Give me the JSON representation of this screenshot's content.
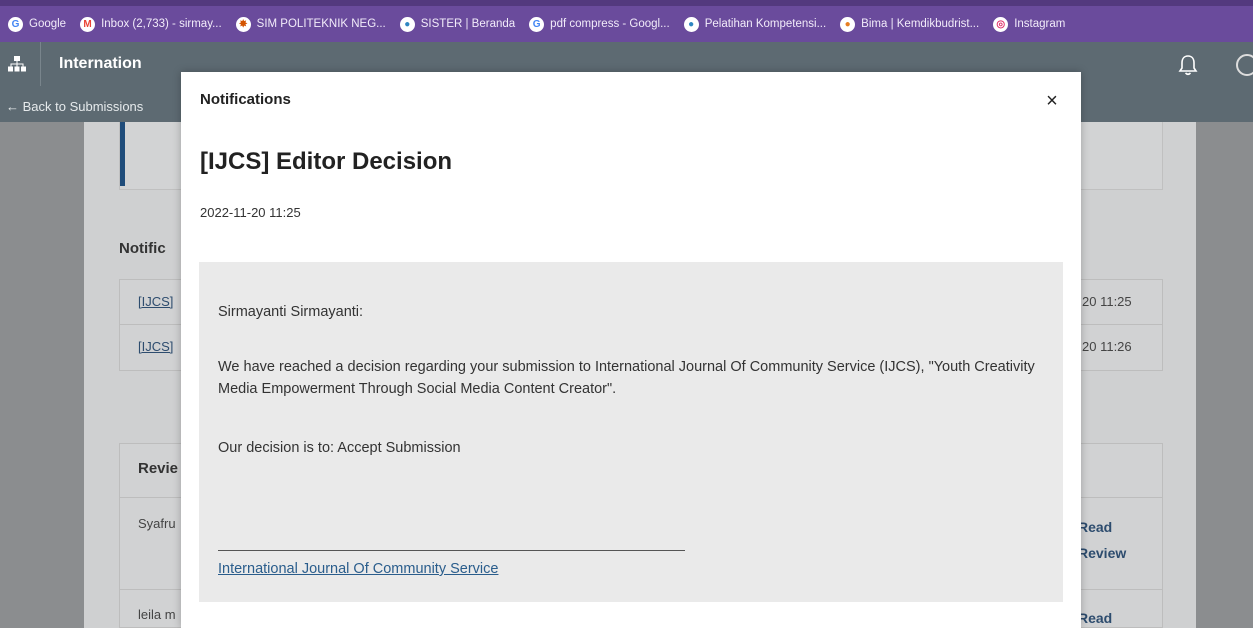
{
  "bookmarks": [
    {
      "label": "Google",
      "icon": "google-icon",
      "color": "#4285f4"
    },
    {
      "label": "Inbox (2,733) - sirmay...",
      "icon": "gmail-icon",
      "color": "#ea4335"
    },
    {
      "label": "SIM POLITEKNIK NEG...",
      "icon": "politeknik-icon",
      "color": "#d35400"
    },
    {
      "label": "SISTER | Beranda",
      "icon": "sister-icon",
      "color": "#2e86c1"
    },
    {
      "label": "pdf compress - Googl...",
      "icon": "google-icon",
      "color": "#4285f4"
    },
    {
      "label": "Pelatihan Kompetensi...",
      "icon": "kemdikbud-icon",
      "color": "#2e86c1"
    },
    {
      "label": "Bima | Kemdikbudrist...",
      "icon": "bima-icon",
      "color": "#e67e22"
    },
    {
      "label": "Instagram",
      "icon": "instagram-icon",
      "color": "#e1306c"
    }
  ],
  "app": {
    "title": "Internation",
    "back_link": "← Back to Submissions"
  },
  "background": {
    "notifications_heading": "Notific",
    "rows": [
      {
        "link": "[IJCS]",
        "time": "20 11:25"
      },
      {
        "link": "[IJCS]",
        "time": "20 11:26"
      }
    ],
    "review_heading": "Revie",
    "reviewers": [
      "Syafru",
      "leila m"
    ],
    "read_review": [
      "Read Review",
      "Read"
    ]
  },
  "modal": {
    "title": "Notifications",
    "close": "×",
    "subject": "[IJCS] Editor Decision",
    "date": "2022-11-20 11:25",
    "greeting": "Sirmayanti Sirmayanti:",
    "paragraph": "We have reached a decision regarding your submission to International Journal Of Community Service (IJCS), \"Youth Creativity Media Empowerment Through Social Media Content Creator\".",
    "decision": "Our decision is to: Accept Submission",
    "signature_link": "International Journal Of Community Service"
  },
  "colors": {
    "bookmark_bar": "#6a4b9c",
    "app_header": "#5d6a72",
    "link": "#2a5d8c"
  }
}
